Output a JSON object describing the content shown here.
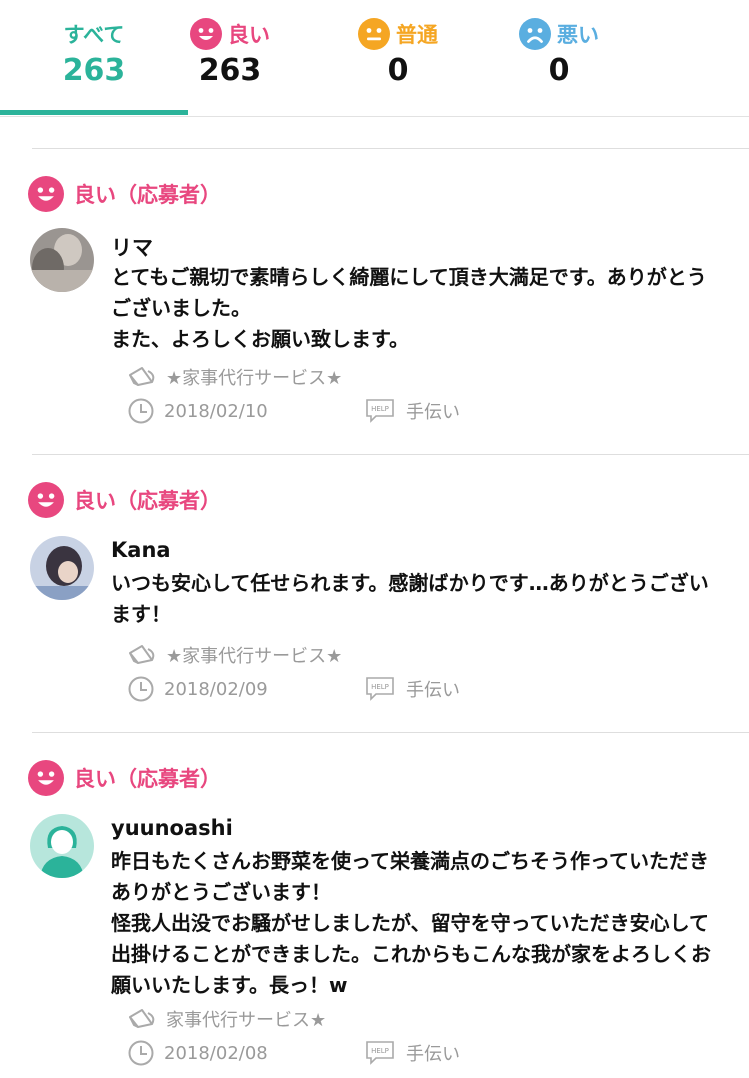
{
  "tabs": [
    {
      "label": "すべて",
      "count": "263",
      "color": "#2bb39a",
      "active": true
    },
    {
      "label": "良い",
      "count": "263",
      "color": "#e8477f",
      "icon": "smile-face-icon"
    },
    {
      "label": "普通",
      "count": "0",
      "color": "#f5a623",
      "icon": "neutral-face-icon"
    },
    {
      "label": "悪い",
      "count": "0",
      "color": "#5aaee0",
      "icon": "sad-face-icon"
    }
  ],
  "reviews": [
    {
      "rating": "良い（応募者）",
      "name": "リマ",
      "text": "とてもご親切で素晴らしく綺麗にして頂き大満足です。ありがとうございました。\nまた、よろしくお願い致します。",
      "service": "★家事代行サービス★",
      "date": "2018/02/10",
      "category": "手伝い"
    },
    {
      "rating": "良い（応募者）",
      "name": "Kana",
      "text": "いつも安心して任せられます。感謝ばかりです…ありがとうございます！",
      "service": "★家事代行サービス★",
      "date": "2018/02/09",
      "category": "手伝い"
    },
    {
      "rating": "良い（応募者）",
      "name": "yuunoashi",
      "text": "昨日もたくさんお野菜を使って栄養満点のごちそう作っていただきありがとうございます！\n怪我人出没でお騒がせしましたが、留守を守っていただき安心して出掛けることができました。これからもこんな我が家をよろしくお願いいたします。長っ！w",
      "service": "家事代行サービス★",
      "date": "2018/02/08",
      "category": "手伝い"
    }
  ]
}
